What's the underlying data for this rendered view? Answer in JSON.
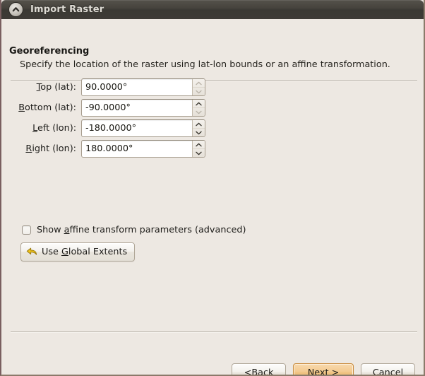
{
  "window": {
    "title": "Import Raster",
    "icon": "up-chevron-circle-icon"
  },
  "header": {
    "title": "Georeferencing",
    "subtitle": "Specify the location of the raster using lat-lon bounds or an affine transformation."
  },
  "form": {
    "fields": [
      {
        "label_pre": "",
        "mnemonic": "T",
        "label_post": "op (lat):",
        "value": "90.0000°",
        "spinner_up_enabled": false,
        "spinner_down_enabled": false
      },
      {
        "label_pre": "",
        "mnemonic": "B",
        "label_post": "ottom (lat):",
        "value": "-90.0000°",
        "spinner_up_enabled": true,
        "spinner_down_enabled": false
      },
      {
        "label_pre": "",
        "mnemonic": "L",
        "label_post": "eft (lon):",
        "value": "-180.0000°",
        "spinner_up_enabled": true,
        "spinner_down_enabled": true
      },
      {
        "label_pre": "",
        "mnemonic": "R",
        "label_post": "ight (lon):",
        "value": "180.0000°",
        "spinner_up_enabled": true,
        "spinner_down_enabled": true
      }
    ]
  },
  "options": {
    "affine_checkbox": {
      "label_pre": "Show ",
      "mnemonic": "a",
      "label_post": "ffine transform parameters (advanced)",
      "checked": false
    },
    "global_extents_button": {
      "label_pre": "Use ",
      "mnemonic": "G",
      "label_post": "lobal Extents",
      "icon": "undo-arrow-icon",
      "icon_color": "#e8b51d"
    }
  },
  "footer": {
    "back": {
      "label_pre": "< ",
      "mnemonic": "B",
      "label_post": "ack"
    },
    "next": {
      "label_pre": "",
      "mnemonic": "N",
      "label_post": "ext >",
      "is_default": true
    },
    "cancel": {
      "label": "Cancel"
    }
  },
  "colors": {
    "window_background": "#EDE8E2",
    "titlebar": "#3E3B36",
    "default_button_accent": "#C98A3A",
    "field_background": "#FFFFFF"
  }
}
